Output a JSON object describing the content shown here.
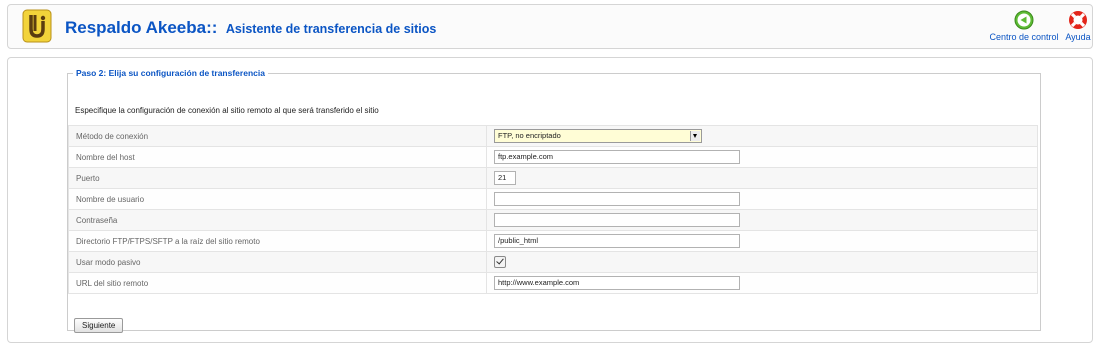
{
  "header": {
    "title_main": "Respaldo Akeeba::",
    "title_sub": "Asistente de transferencia de sitios",
    "logo_icon": "akeeba-logo-icon",
    "buttons": [
      {
        "label": "Centro de control",
        "icon": "control-panel-icon",
        "color": "#4caf2a"
      },
      {
        "label": "Ayuda",
        "icon": "lifebuoy-help-icon",
        "color": "#e3251a"
      }
    ]
  },
  "step": {
    "legend": "Paso 2: Elija su configuración de transferencia",
    "intro": "Especifique la configuración de conexión al sitio remoto al que será transferido el sitio",
    "fields": {
      "method": {
        "label": "Método de conexión",
        "value": "FTP, no encriptado"
      },
      "host": {
        "label": "Nombre del host",
        "value": "ftp.example.com"
      },
      "port": {
        "label": "Puerto",
        "value": "21"
      },
      "username": {
        "label": "Nombre de usuario",
        "value": ""
      },
      "password": {
        "label": "Contraseña",
        "value": ""
      },
      "directory": {
        "label": "Directorio FTP/FTPS/SFTP a la raíz del sitio remoto",
        "value": "/public_html"
      },
      "passive": {
        "label": "Usar modo pasivo",
        "checked": true
      },
      "url": {
        "label": "URL del sitio remoto",
        "value": "http://www.example.com"
      }
    },
    "next_label": "Siguiente"
  },
  "colors": {
    "accent": "#0b55c4",
    "select_bg": "#fffdd6"
  }
}
